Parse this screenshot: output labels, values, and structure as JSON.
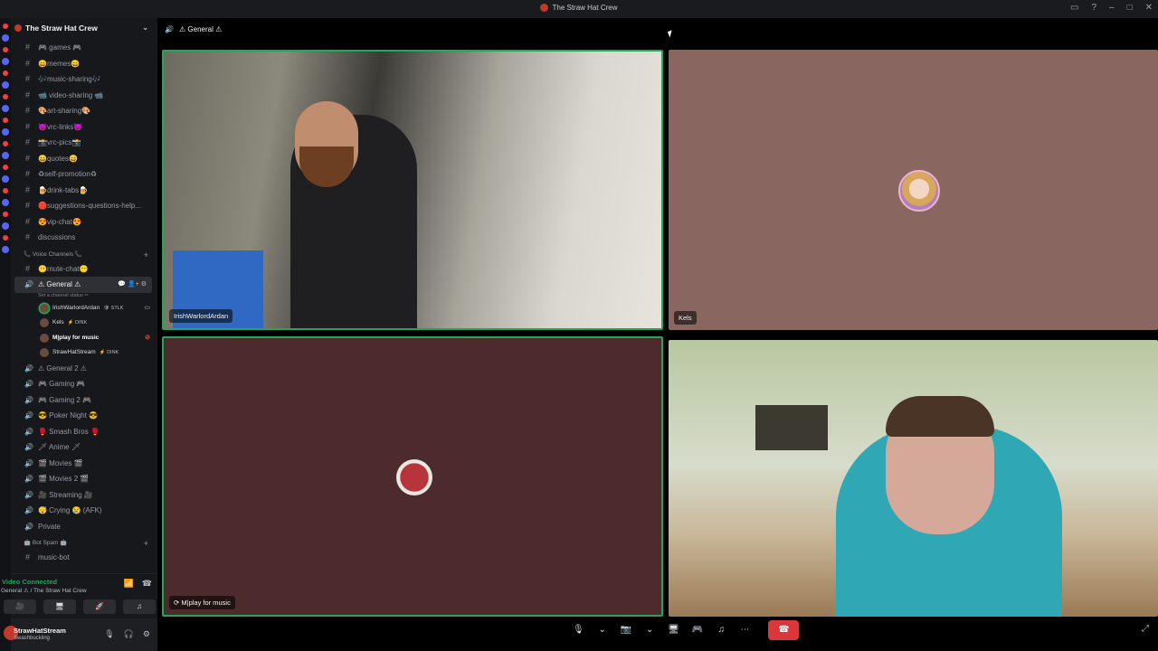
{
  "window": {
    "title": "The Straw Hat Crew"
  },
  "server": {
    "name": "The Straw Hat Crew"
  },
  "text_channels": [
    {
      "label": "🎮 games 🎮"
    },
    {
      "label": "😄memes😄"
    },
    {
      "label": "🎶music-sharing🎶"
    },
    {
      "label": "📹 video-sharing 📹"
    },
    {
      "label": "🎨art-sharing🎨"
    },
    {
      "label": "😈vrc-links😈"
    },
    {
      "label": "📸vrc-pics📸"
    },
    {
      "label": "😄quotes😄"
    },
    {
      "label": "♻self-promotion♻"
    },
    {
      "label": "🍺drink-tabs🍺"
    },
    {
      "label": "🛑suggestions-questions-help..."
    },
    {
      "label": "😍vip-chat😍"
    },
    {
      "label": "discussions"
    }
  ],
  "voice_category": {
    "label": "📞 Voice Channels 📞"
  },
  "mute_channel": {
    "label": "😶mute-chat😶"
  },
  "active_channel": {
    "label": "⚠ General ⚠",
    "status": "Set a channel status ✏"
  },
  "voice_users": [
    {
      "name": "IrishWarlordArdan",
      "tag": "🛡 STLK"
    },
    {
      "name": "Kels",
      "tag": "⚡ DINK"
    },
    {
      "name": "M|play for music",
      "tag": ""
    },
    {
      "name": "StrawHatStream",
      "tag": "⚡ DINK"
    }
  ],
  "voice_channels": [
    {
      "label": "⚠ General 2 ⚠"
    },
    {
      "label": "🎮 Gaming 🎮"
    },
    {
      "label": "🎮 Gaming 2 🎮"
    },
    {
      "label": "😎 Poker Night 😎"
    },
    {
      "label": "🥊 Smash Bros 🥊"
    },
    {
      "label": "🗡 Anime 🗡"
    },
    {
      "label": "🎬 Movies 🎬"
    },
    {
      "label": "🎬 Movies 2 🎬"
    },
    {
      "label": "🎥 Streaming 🎥"
    },
    {
      "label": "😴 Crying 😢 (AFK)"
    },
    {
      "label": "Private"
    }
  ],
  "bot_category": {
    "label": "🤖 Bot Spam 🤖"
  },
  "bot_channels": [
    {
      "label": "music-bot"
    }
  ],
  "voice_panel": {
    "status": "Video Connected",
    "location": "General ⚠ / The Straw Hat Crew"
  },
  "user_panel": {
    "name": "StrawHatStream",
    "status": "Swashbuckling"
  },
  "call": {
    "channel_title": "⚠ General ⚠",
    "tiles": [
      {
        "label": "IrishWarlordArdan"
      },
      {
        "label": "Kels"
      },
      {
        "label": "M|play for music"
      }
    ]
  },
  "colors": {
    "speaking": "#23a55a",
    "end_call": "#da373c",
    "sidebar": "#17181b"
  }
}
